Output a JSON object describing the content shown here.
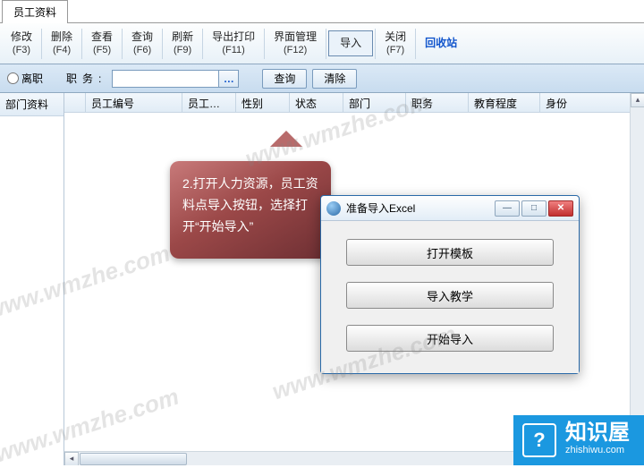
{
  "tab": {
    "label": "员工资料"
  },
  "toolbar": {
    "items": [
      {
        "label": "修改",
        "shortcut": "(F3)"
      },
      {
        "label": "删除",
        "shortcut": "(F4)"
      },
      {
        "label": "查看",
        "shortcut": "(F5)"
      },
      {
        "label": "查询",
        "shortcut": "(F6)"
      },
      {
        "label": "刷新",
        "shortcut": "(F9)"
      },
      {
        "label": "导出打印",
        "shortcut": "(F11)"
      },
      {
        "label": "界面管理",
        "shortcut": "(F12)"
      }
    ],
    "import_label": "导入",
    "close": {
      "label": "关闭",
      "shortcut": "(F7)"
    },
    "recycle_label": "回收站"
  },
  "filter": {
    "radio_label": "离职",
    "field_label": "职务:",
    "field_value": "",
    "picker_glyph": "…",
    "query_btn": "查询",
    "clear_btn": "清除"
  },
  "sidebar": {
    "header": "部门资料"
  },
  "grid": {
    "columns": [
      "员工编号",
      "员工…",
      "性别",
      "状态",
      "部门",
      "职务",
      "教育程度",
      "身份"
    ]
  },
  "callout": {
    "text": "2.打开人力资源，员工资料点导入按钮，选择打开“开始导入”"
  },
  "dialog": {
    "title": "准备导入Excel",
    "buttons": [
      "打开模板",
      "导入教学",
      "开始导入"
    ],
    "min_glyph": "—",
    "max_glyph": "□",
    "close_glyph": "✕"
  },
  "brand": {
    "logo_glyph": "?",
    "name": "知识屋",
    "url": "zhishiwu.com"
  },
  "watermark": "www.wmzhe.com"
}
